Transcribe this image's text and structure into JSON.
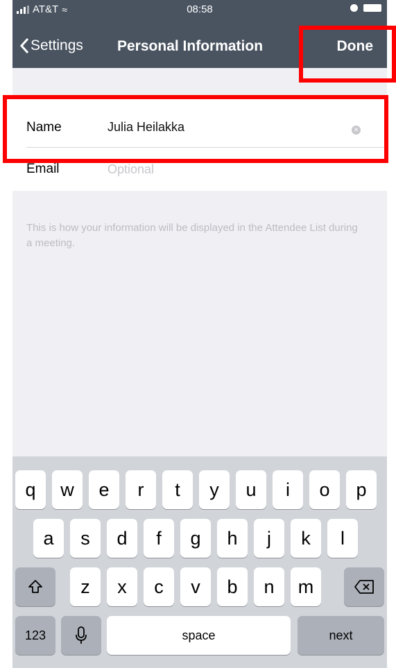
{
  "status_bar": {
    "carrier": "AT&T",
    "time": "08:58"
  },
  "nav": {
    "back_label": "Settings",
    "title": "Personal Information",
    "done_label": "Done"
  },
  "form": {
    "name_label": "Name",
    "name_value": "Julia Heilakka",
    "email_label": "Email",
    "email_placeholder": "Optional"
  },
  "hint_text": "This is how your information will be displayed in the Attendee List during a meeting.",
  "keyboard": {
    "row1": [
      "q",
      "w",
      "e",
      "r",
      "t",
      "y",
      "u",
      "i",
      "o",
      "p"
    ],
    "row2": [
      "a",
      "s",
      "d",
      "f",
      "g",
      "h",
      "j",
      "k",
      "l"
    ],
    "row3": [
      "z",
      "x",
      "c",
      "v",
      "b",
      "n",
      "m"
    ],
    "numbers_label": "123",
    "space_label": "space",
    "next_label": "next"
  },
  "colors": {
    "nav_background": "#4a5461",
    "annotation": "#ff0000",
    "keyboard_background": "#d1d4d9"
  }
}
